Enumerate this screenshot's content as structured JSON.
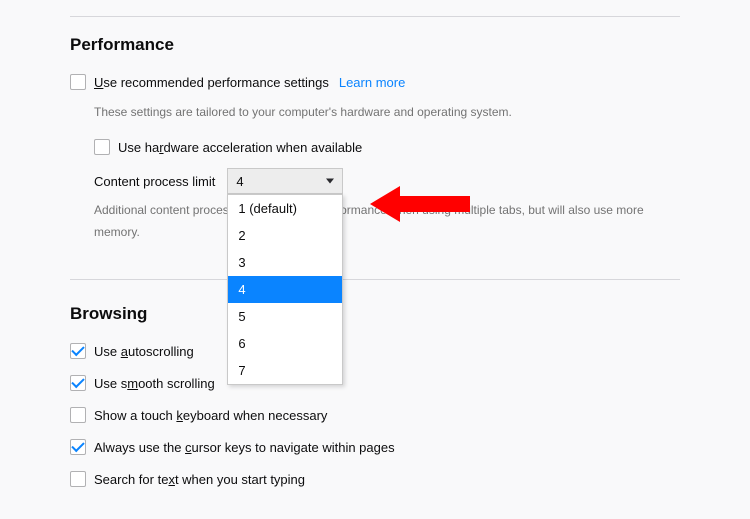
{
  "performance": {
    "title": "Performance",
    "recommended_label_pre": "U",
    "recommended_label_post": "se recommended performance settings",
    "learn_more": "Learn more",
    "hint": "These settings are tailored to your computer's hardware and operating system.",
    "hw_accel_pre": "Use ha",
    "hw_accel_ul": "r",
    "hw_accel_post": "dware acceleration when available",
    "limit_label_pre": "Content process ",
    "limit_label_ul": "l",
    "limit_label_post": "imit",
    "selected_value": "4",
    "options": [
      "1 (default)",
      "2",
      "3",
      "4",
      "5",
      "6",
      "7"
    ],
    "selected_index": 3,
    "additional_hint": "Additional content processes can improve performance when using multiple tabs, but will also use more memory."
  },
  "browsing": {
    "title": "Browsing",
    "autoscroll_pre": "Use ",
    "autoscroll_ul": "a",
    "autoscroll_post": "utoscrolling",
    "smooth_pre": "Use s",
    "smooth_ul": "m",
    "smooth_post": "ooth scrolling",
    "touch_pre": "Show a touch ",
    "touch_ul": "k",
    "touch_post": "eyboard when necessary",
    "cursor_pre": "Always use the ",
    "cursor_ul": "c",
    "cursor_post": "ursor keys to navigate within pages",
    "search_pre": "Search for te",
    "search_ul": "x",
    "search_post": "t when you start typing"
  }
}
